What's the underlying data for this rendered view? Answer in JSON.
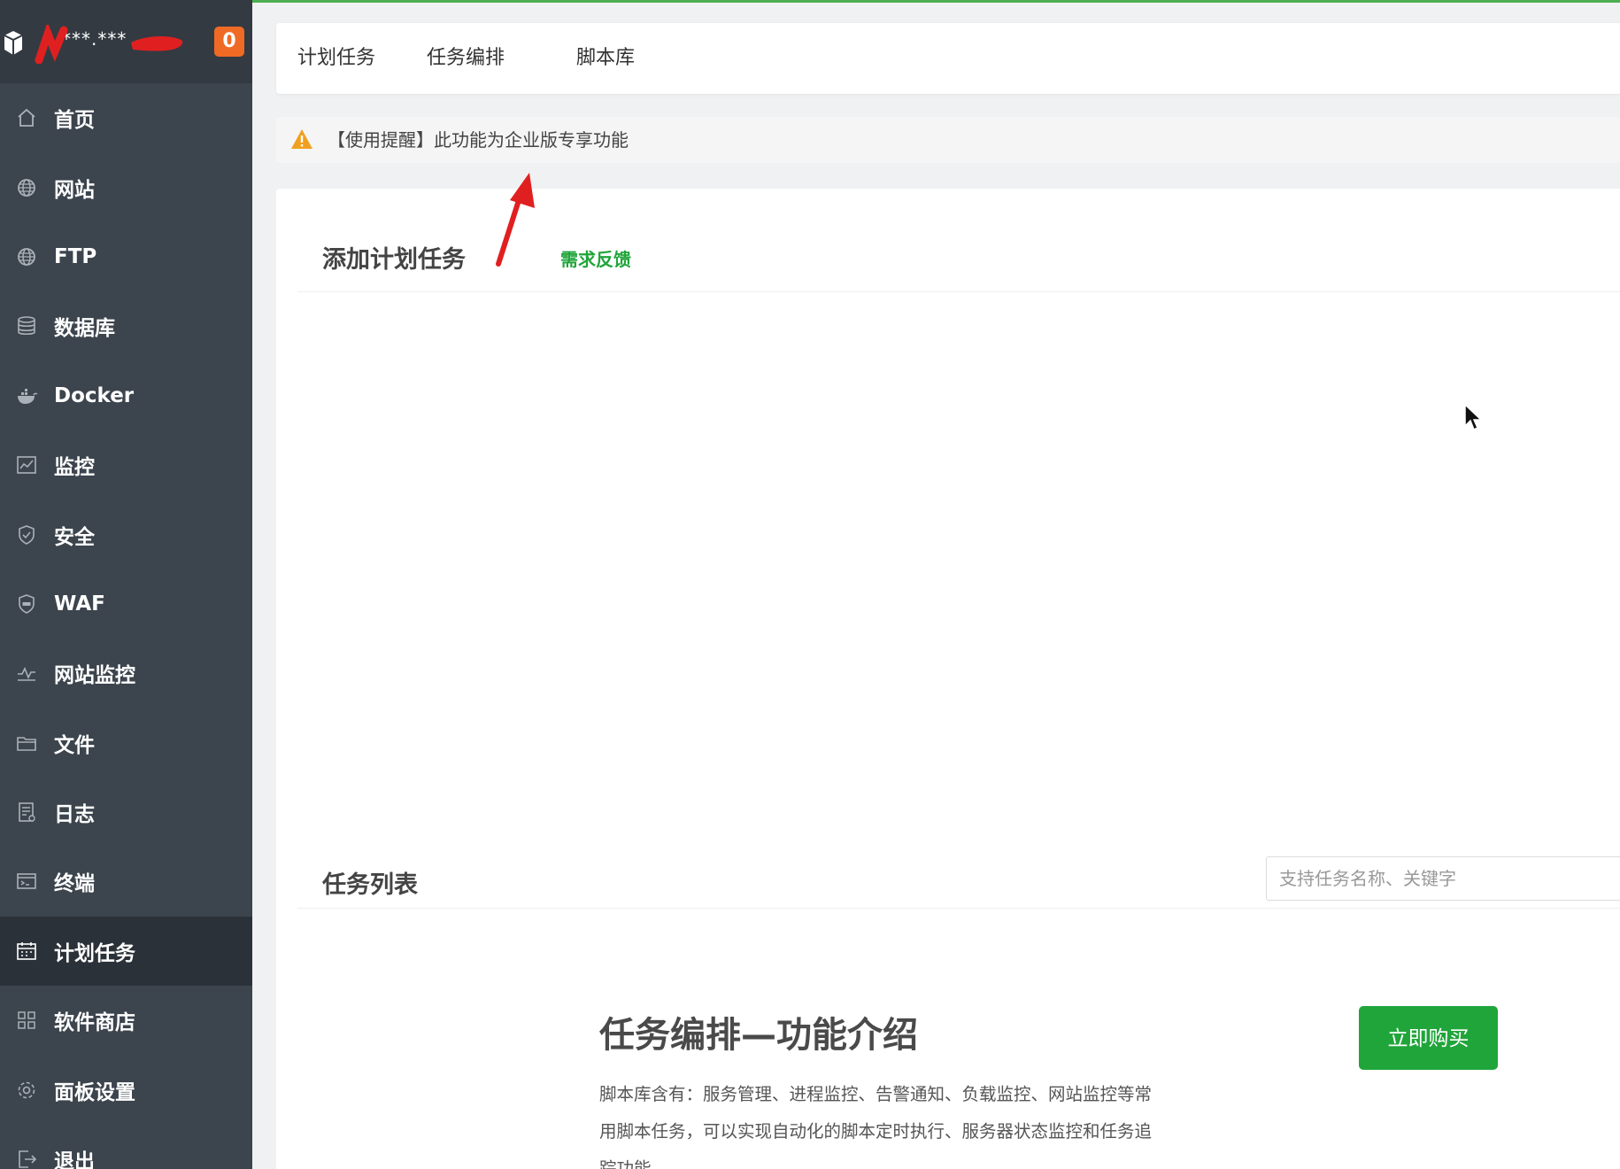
{
  "brand": {
    "name": "***.***",
    "notification_count": "0"
  },
  "sidebar": {
    "items": [
      {
        "label": "首页",
        "icon": "home-icon"
      },
      {
        "label": "网站",
        "icon": "globe-icon"
      },
      {
        "label": "FTP",
        "icon": "globe-icon"
      },
      {
        "label": "数据库",
        "icon": "database-icon"
      },
      {
        "label": "Docker",
        "icon": "docker-icon"
      },
      {
        "label": "监控",
        "icon": "monitor-icon"
      },
      {
        "label": "安全",
        "icon": "shield-icon"
      },
      {
        "label": "WAF",
        "icon": "waf-shield-icon"
      },
      {
        "label": "网站监控",
        "icon": "pulse-icon"
      },
      {
        "label": "文件",
        "icon": "folder-icon"
      },
      {
        "label": "日志",
        "icon": "log-icon"
      },
      {
        "label": "终端",
        "icon": "terminal-icon"
      },
      {
        "label": "计划任务",
        "icon": "calendar-icon",
        "active": true
      },
      {
        "label": "软件商店",
        "icon": "grid-icon"
      },
      {
        "label": "面板设置",
        "icon": "gear-icon"
      },
      {
        "label": "退出",
        "icon": "logout-icon"
      }
    ]
  },
  "tabs": [
    {
      "label": "计划任务"
    },
    {
      "label": "任务编排"
    },
    {
      "label": "脚本库"
    }
  ],
  "notice": {
    "text": "【使用提醒】此功能为企业版专享功能"
  },
  "add_task": {
    "title": "添加计划任务",
    "feedback_link": "需求反馈"
  },
  "task_list": {
    "title": "任务列表",
    "search_placeholder": "支持任务名称、关键字"
  },
  "intro": {
    "title": "任务编排—功能介绍",
    "description": "脚本库含有：服务管理、进程监控、告警通知、负载监控、网站监控等常用脚本任务，可以实现自动化的脚本定时执行、服务器状态监控和任务追踪功能。",
    "buy_button": "立即购买"
  },
  "colors": {
    "sidebar_bg": "#3c444d",
    "sidebar_active_bg": "#2b3138",
    "accent_green": "#20a53a",
    "badge_orange": "#ef6a24",
    "warning_orange": "#f0a020",
    "annotation_red": "#e02020"
  }
}
